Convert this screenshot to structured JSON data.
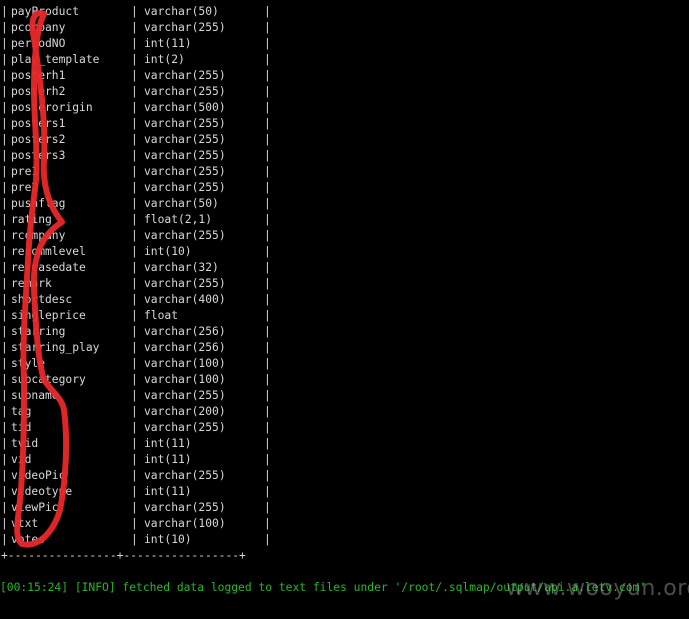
{
  "rows": [
    {
      "name": "payProduct",
      "type": "varchar(50)"
    },
    {
      "name": "pcompany",
      "type": "varchar(255)"
    },
    {
      "name": "periodNO",
      "type": "int(11)"
    },
    {
      "name": "play_template",
      "type": "int(2)"
    },
    {
      "name": "posterh1",
      "type": "varchar(255)"
    },
    {
      "name": "posterh2",
      "type": "varchar(255)"
    },
    {
      "name": "posterorigin",
      "type": "varchar(500)"
    },
    {
      "name": "posters1",
      "type": "varchar(255)"
    },
    {
      "name": "posters2",
      "type": "varchar(255)"
    },
    {
      "name": "posters3",
      "type": "varchar(255)"
    },
    {
      "name": "pre1",
      "type": "varchar(255)"
    },
    {
      "name": "pre2",
      "type": "varchar(255)"
    },
    {
      "name": "pushflag",
      "type": "varchar(50)"
    },
    {
      "name": "rating",
      "type": "float(2,1)"
    },
    {
      "name": "rcompany",
      "type": "varchar(255)"
    },
    {
      "name": "recommlevel",
      "type": "int(10)"
    },
    {
      "name": "releasedate",
      "type": "varchar(32)"
    },
    {
      "name": "remark",
      "type": "varchar(255)"
    },
    {
      "name": "shortdesc",
      "type": "varchar(400)"
    },
    {
      "name": "singleprice",
      "type": "float"
    },
    {
      "name": "starring",
      "type": "varchar(256)"
    },
    {
      "name": "starring_play",
      "type": "varchar(256)"
    },
    {
      "name": "style",
      "type": "varchar(100)"
    },
    {
      "name": "subcategory",
      "type": "varchar(100)"
    },
    {
      "name": "subname",
      "type": "varchar(255)"
    },
    {
      "name": "tag",
      "type": "varchar(200)"
    },
    {
      "name": "tid",
      "type": "varchar(255)"
    },
    {
      "name": "tvid",
      "type": "int(11)"
    },
    {
      "name": "vid",
      "type": "int(11)"
    },
    {
      "name": "videoPic",
      "type": "varchar(255)"
    },
    {
      "name": "videotype",
      "type": "int(11)"
    },
    {
      "name": "viewPic",
      "type": "varchar(255)"
    },
    {
      "name": "vtxt",
      "type": "varchar(100)"
    },
    {
      "name": "votes",
      "type": "int(10)"
    }
  ],
  "separator": "|",
  "table_border": "+----------------+-----------------+",
  "log_line": "[00:15:24] [INFO] fetched data logged to text files under '/root/.sqlmap/output/api.a.letv.com'",
  "watermark": "www.wooyun.org",
  "colors": {
    "background": "#000000",
    "text": "#d8d8d8",
    "log": "#2bb52b",
    "annotation": "#e8282a"
  }
}
